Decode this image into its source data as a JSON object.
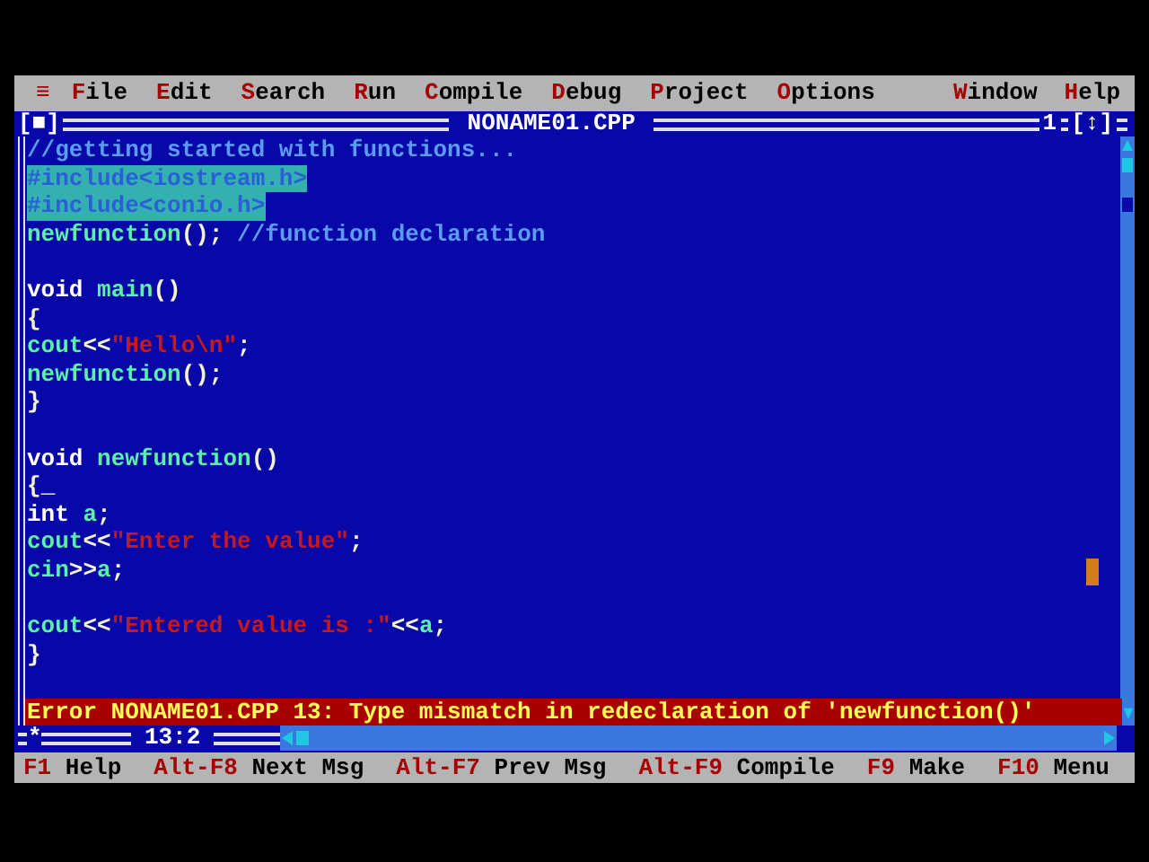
{
  "menu": {
    "system": "≡",
    "left": [
      {
        "label": "File"
      },
      {
        "label": "Edit"
      },
      {
        "label": "Search"
      },
      {
        "label": "Run"
      },
      {
        "label": "Compile"
      },
      {
        "label": "Debug"
      },
      {
        "label": "Project"
      },
      {
        "label": "Options"
      }
    ],
    "right": [
      {
        "label": "Window"
      },
      {
        "label": "Help"
      }
    ]
  },
  "window": {
    "close_box": "[■]",
    "title": "NONAME01.CPP",
    "number": "1",
    "zoom_box": "[↕]",
    "lines": [
      {
        "selected": false,
        "tokens": [
          {
            "kind": "comment",
            "text": "//getting started with functions..."
          }
        ]
      },
      {
        "selected": true,
        "tokens": [
          {
            "kind": "directive",
            "text": "#include<iostream.h>"
          }
        ]
      },
      {
        "selected": true,
        "tokens": [
          {
            "kind": "directive",
            "text": "#include<conio.h>"
          }
        ]
      },
      {
        "selected": false,
        "tokens": [
          {
            "kind": "ident",
            "text": "newfunction"
          },
          {
            "kind": "symbol",
            "text": "(); "
          },
          {
            "kind": "comment",
            "text": "//function declaration"
          }
        ]
      },
      {
        "selected": false
      },
      {
        "selected": false,
        "tokens": [
          {
            "kind": "keyword",
            "text": "void "
          },
          {
            "kind": "ident",
            "text": "main"
          },
          {
            "kind": "symbol",
            "text": "()"
          }
        ]
      },
      {
        "selected": false,
        "tokens": [
          {
            "kind": "symbol",
            "text": "{"
          }
        ]
      },
      {
        "selected": false,
        "tokens": [
          {
            "kind": "ident",
            "text": "cout"
          },
          {
            "kind": "symbol",
            "text": "<<"
          },
          {
            "kind": "string",
            "text": "\"Hello\\n\""
          },
          {
            "kind": "symbol",
            "text": ";"
          }
        ]
      },
      {
        "selected": false,
        "tokens": [
          {
            "kind": "ident",
            "text": "newfunction"
          },
          {
            "kind": "symbol",
            "text": "();"
          }
        ]
      },
      {
        "selected": false,
        "tokens": [
          {
            "kind": "symbol",
            "text": "}"
          }
        ]
      },
      {
        "selected": false
      },
      {
        "selected": false,
        "tokens": [
          {
            "kind": "keyword",
            "text": "void "
          },
          {
            "kind": "ident",
            "text": "newfunction"
          },
          {
            "kind": "symbol",
            "text": "()"
          }
        ]
      },
      {
        "selected": false,
        "tokens": [
          {
            "kind": "symbol",
            "text": "{"
          },
          {
            "kind": "cursor",
            "text": "_"
          }
        ]
      },
      {
        "selected": false,
        "tokens": [
          {
            "kind": "keyword",
            "text": "int "
          },
          {
            "kind": "ident",
            "text": "a"
          },
          {
            "kind": "symbol",
            "text": ";"
          }
        ]
      },
      {
        "selected": false,
        "tokens": [
          {
            "kind": "ident",
            "text": "cout"
          },
          {
            "kind": "symbol",
            "text": "<<"
          },
          {
            "kind": "string",
            "text": "\"Enter the value\""
          },
          {
            "kind": "symbol",
            "text": ";"
          }
        ]
      },
      {
        "selected": false,
        "tokens": [
          {
            "kind": "ident",
            "text": "cin"
          },
          {
            "kind": "symbol",
            "text": ">>"
          },
          {
            "kind": "ident",
            "text": "a"
          },
          {
            "kind": "symbol",
            "text": ";"
          }
        ]
      },
      {
        "selected": false
      },
      {
        "selected": false,
        "tokens": [
          {
            "kind": "ident",
            "text": "cout"
          },
          {
            "kind": "symbol",
            "text": "<<"
          },
          {
            "kind": "string",
            "text": "\"Entered value is :\""
          },
          {
            "kind": "symbol",
            "text": "<<"
          },
          {
            "kind": "ident",
            "text": "a"
          },
          {
            "kind": "symbol",
            "text": ";"
          }
        ]
      },
      {
        "selected": false,
        "tokens": [
          {
            "kind": "symbol",
            "text": "}"
          }
        ]
      }
    ],
    "error": "Error NONAME01.CPP 13: Type mismatch in redeclaration of 'newfunction()'",
    "modified_mark": "*",
    "position": "13:2"
  },
  "status_bar": [
    {
      "key": "F1",
      "label": "Help"
    },
    {
      "key": "Alt-F8",
      "label": "Next Msg"
    },
    {
      "key": "Alt-F7",
      "label": "Prev Msg"
    },
    {
      "key": "Alt-F9",
      "label": "Compile"
    },
    {
      "key": "F9",
      "label": "Make"
    },
    {
      "key": "F10",
      "label": "Menu"
    }
  ]
}
